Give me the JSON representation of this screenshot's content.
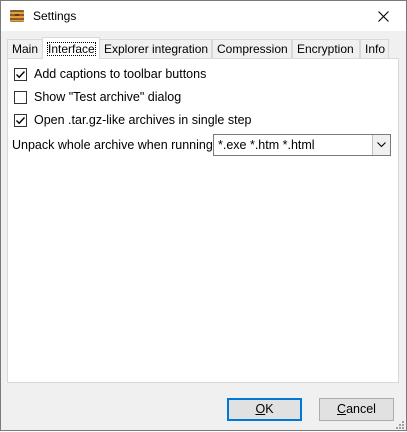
{
  "window": {
    "title": "Settings",
    "close_icon": "close-icon",
    "app_icon": "archive-icon"
  },
  "tabs": [
    {
      "label": "Main",
      "active": false
    },
    {
      "label": "Interface",
      "active": true
    },
    {
      "label": "Explorer integration",
      "active": false
    },
    {
      "label": "Compression",
      "active": false
    },
    {
      "label": "Encryption",
      "active": false
    },
    {
      "label": "Info",
      "active": false
    }
  ],
  "options": [
    {
      "label": "Add captions to toolbar buttons",
      "checked": true
    },
    {
      "label": "Show \"Test archive\" dialog",
      "checked": false
    },
    {
      "label": "Open .tar.gz-like archives in single step",
      "checked": true
    }
  ],
  "unpack": {
    "label": "Unpack whole archive when running:",
    "value": "*.exe *.htm *.html"
  },
  "buttons": {
    "ok": {
      "mnemonic": "O",
      "rest": "K"
    },
    "cancel": {
      "mnemonic": "C",
      "rest": "ancel"
    }
  }
}
